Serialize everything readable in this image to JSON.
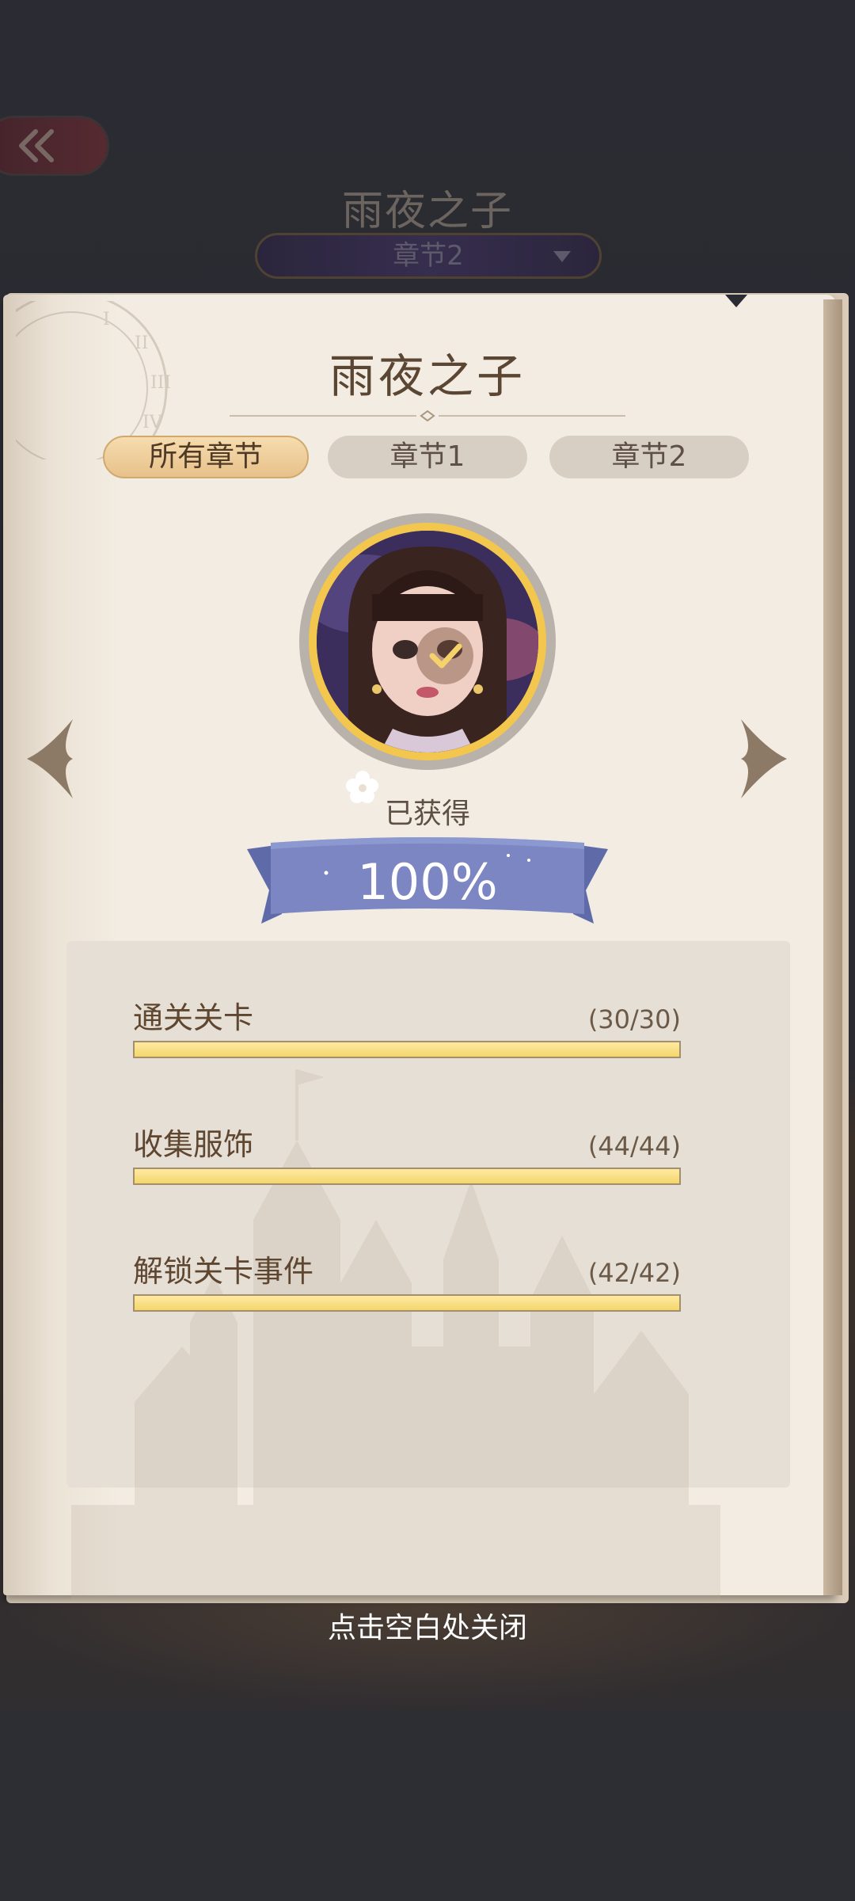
{
  "background": {
    "title": "雨夜之子",
    "chapter_select": "章节2"
  },
  "panel": {
    "title": "雨夜之子",
    "tabs": [
      {
        "label": "所有章节",
        "active": true
      },
      {
        "label": "章节1",
        "active": false
      },
      {
        "label": "章节2",
        "active": false
      }
    ],
    "status": "已获得",
    "progress_text": "100%",
    "stats": [
      {
        "label": "通关关卡",
        "count": "(30/30)",
        "progress": 1.0
      },
      {
        "label": "收集服饰",
        "count": "(44/44)",
        "progress": 1.0
      },
      {
        "label": "解锁关卡事件",
        "count": "(42/42)",
        "progress": 1.0
      }
    ]
  },
  "close_hint": "点击空白处关闭",
  "colors": {
    "ribbon": "#7b86c2",
    "bar_fill": "#f4d66d",
    "avatar_ring": "#f3c64e",
    "active_tab": "#e7c18a"
  },
  "icons": {
    "back": "double-chevron-left-icon",
    "prev": "chevron-left-icon",
    "next": "chevron-right-icon",
    "check": "check-icon"
  }
}
